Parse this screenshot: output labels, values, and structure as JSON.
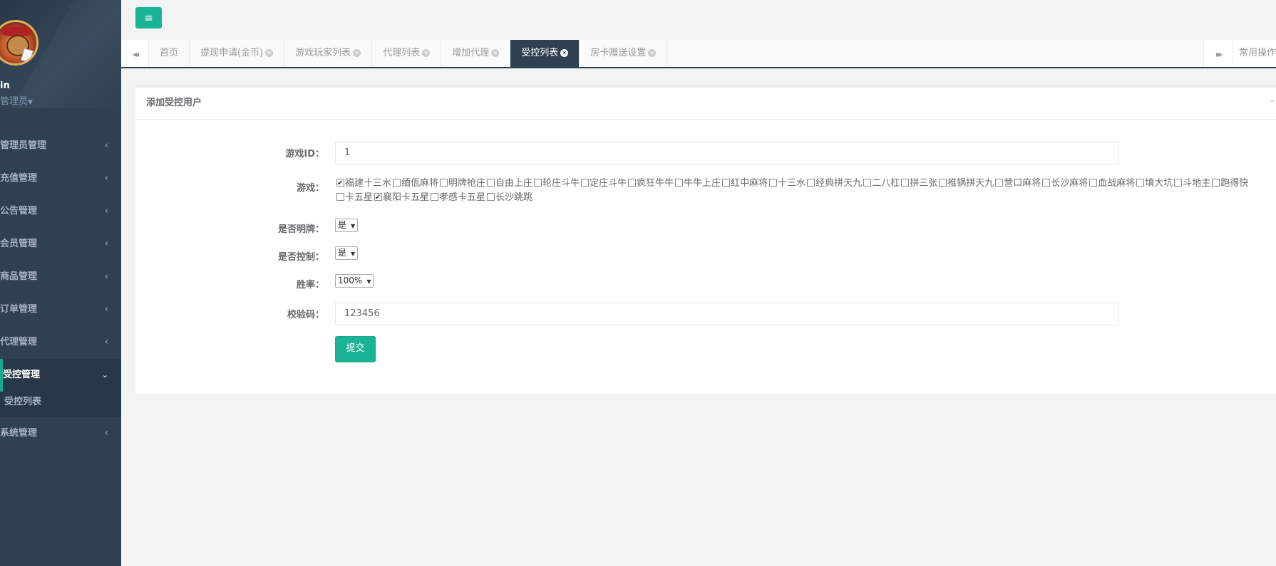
{
  "sidebar": {
    "username": "in",
    "role": "管理员",
    "items": [
      {
        "label": "管理员管理"
      },
      {
        "label": "充值管理"
      },
      {
        "label": "公告管理"
      },
      {
        "label": "会员管理"
      },
      {
        "label": "商品管理"
      },
      {
        "label": "订单管理"
      },
      {
        "label": "代理管理"
      },
      {
        "label": "受控管理"
      },
      {
        "label": "系统管理"
      }
    ],
    "active_sub": "受控列表",
    "chevron": "‹",
    "chevron_down": "⌄"
  },
  "topbar": {
    "menu_icon": "≡"
  },
  "tabs": {
    "items": [
      {
        "label": "首页"
      },
      {
        "label": "提现申请(金币)"
      },
      {
        "label": "游戏玩家列表"
      },
      {
        "label": "代理列表"
      },
      {
        "label": "增加代理"
      },
      {
        "label": "受控列表"
      },
      {
        "label": "房卡赠送设置"
      }
    ],
    "active": "受控列表",
    "back_icon": "◀◀",
    "forward_icon": "▶▶",
    "ops_label": "常用操作"
  },
  "form": {
    "title": "添加受控用户",
    "game_id_label": "游戏ID：",
    "game_id_value": "1",
    "games_label": "游戏：",
    "games": [
      {
        "name": "福建十三水",
        "checked": true
      },
      {
        "name": "缅佤麻将",
        "checked": false
      },
      {
        "name": "明牌抢庄",
        "checked": false
      },
      {
        "name": "自由上庄",
        "checked": false
      },
      {
        "name": "轮庄斗牛",
        "checked": false
      },
      {
        "name": "定庄斗牛",
        "checked": false
      },
      {
        "name": "疯狂牛牛",
        "checked": false
      },
      {
        "name": "牛牛上庄",
        "checked": false
      },
      {
        "name": "红中麻将",
        "checked": false
      },
      {
        "name": "十三水",
        "checked": false
      },
      {
        "name": "经典拼天九",
        "checked": false
      },
      {
        "name": "二八杠",
        "checked": false
      },
      {
        "name": "拼三张",
        "checked": false
      },
      {
        "name": "推锅拼天九",
        "checked": false
      },
      {
        "name": "营口麻将",
        "checked": false
      },
      {
        "name": "长沙麻将",
        "checked": false
      },
      {
        "name": "血战麻将",
        "checked": false
      },
      {
        "name": "填大坑",
        "checked": false
      },
      {
        "name": "斗地主",
        "checked": false
      },
      {
        "name": "跑得快",
        "checked": false
      },
      {
        "name": "卡五星",
        "checked": false
      },
      {
        "name": "襄阳卡五星",
        "checked": true
      },
      {
        "name": "孝感卡五星",
        "checked": false
      },
      {
        "name": "长沙跳跳",
        "checked": false
      }
    ],
    "show_cards_label": "是否明牌：",
    "show_cards_value": "是",
    "control_label": "是否控制：",
    "control_value": "是",
    "win_rate_label": "胜率：",
    "win_rate_value": "100%",
    "code_label": "校验码：",
    "code_value": "123456",
    "submit_label": "提交"
  }
}
